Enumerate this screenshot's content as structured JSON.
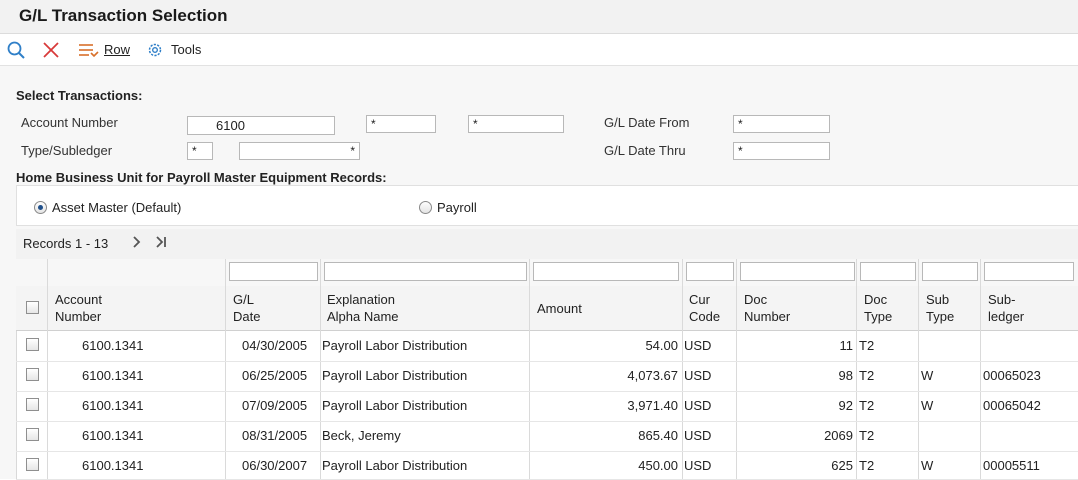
{
  "window": {
    "title": "G/L Transaction Selection"
  },
  "toolbar": {
    "row_label": "Row",
    "tools_label": "Tools"
  },
  "selection": {
    "title": "Select Transactions:",
    "account_number_label": "Account Number",
    "account_number_value": "6100",
    "account_field2_value": "*",
    "account_field3_value": "*",
    "type_subledger_label": "Type/Subledger",
    "type_value": "*",
    "subledger_value": "*",
    "gl_date_from_label": "G/L Date From",
    "gl_date_from_value": "*",
    "gl_date_thru_label": "G/L Date Thru",
    "gl_date_thru_value": "*"
  },
  "home_bu": {
    "title": "Home Business Unit for Payroll Master Equipment Records:",
    "option_asset": "Asset Master (Default)",
    "option_payroll": "Payroll",
    "selected": "asset"
  },
  "grid": {
    "records_label": "Records 1 - 13",
    "columns": [
      {
        "line1": "Account",
        "line2": "Number"
      },
      {
        "line1": "G/L",
        "line2": "Date"
      },
      {
        "line1": "Explanation",
        "line2": "Alpha Name"
      },
      {
        "line1": "Amount",
        "line2": ""
      },
      {
        "line1": "Cur",
        "line2": "Code"
      },
      {
        "line1": "Doc",
        "line2": "Number"
      },
      {
        "line1": "Doc",
        "line2": "Type"
      },
      {
        "line1": "Sub",
        "line2": "Type"
      },
      {
        "line1": "Sub-",
        "line2": "ledger"
      }
    ],
    "rows": [
      {
        "account": "6100.1341",
        "date": "04/30/2005",
        "explanation": "Payroll Labor Distribution",
        "amount": "54.00",
        "cur": "USD",
        "doc_number": "11",
        "doc_type": "T2",
        "sub_type": "",
        "subledger": ""
      },
      {
        "account": "6100.1341",
        "date": "06/25/2005",
        "explanation": "Payroll Labor Distribution",
        "amount": "4,073.67",
        "cur": "USD",
        "doc_number": "98",
        "doc_type": "T2",
        "sub_type": "W",
        "subledger": "00065023"
      },
      {
        "account": "6100.1341",
        "date": "07/09/2005",
        "explanation": "Payroll Labor Distribution",
        "amount": "3,971.40",
        "cur": "USD",
        "doc_number": "92",
        "doc_type": "T2",
        "sub_type": "W",
        "subledger": "00065042"
      },
      {
        "account": "6100.1341",
        "date": "08/31/2005",
        "explanation": "Beck, Jeremy",
        "amount": "865.40",
        "cur": "USD",
        "doc_number": "2069",
        "doc_type": "T2",
        "sub_type": "",
        "subledger": ""
      },
      {
        "account": "6100.1341",
        "date": "06/30/2007",
        "explanation": "Payroll Labor Distribution",
        "amount": "450.00",
        "cur": "USD",
        "doc_number": "625",
        "doc_type": "T2",
        "sub_type": "W",
        "subledger": "00005511"
      }
    ]
  }
}
